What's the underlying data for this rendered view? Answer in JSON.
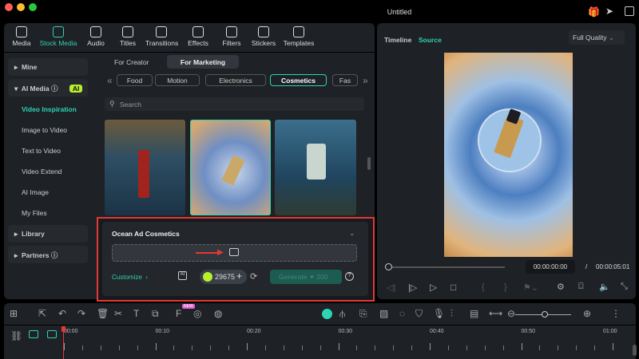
{
  "window": {
    "title": "Untitled"
  },
  "toolbar": [
    {
      "label": "Media",
      "icon": "media-icon"
    },
    {
      "label": "Stock Media",
      "icon": "stock-media-icon",
      "active": true
    },
    {
      "label": "Audio",
      "icon": "audio-icon"
    },
    {
      "label": "Titles",
      "icon": "titles-icon"
    },
    {
      "label": "Transitions",
      "icon": "transitions-icon"
    },
    {
      "label": "Effects",
      "icon": "effects-icon"
    },
    {
      "label": "Filters",
      "icon": "filters-icon"
    },
    {
      "label": "Stickers",
      "icon": "stickers-icon"
    },
    {
      "label": "Templates",
      "icon": "templates-icon"
    }
  ],
  "sidebar": {
    "mine": "Mine",
    "ai_media": "AI Media",
    "ai_badge": "AI",
    "items": [
      "Video Inspiration",
      "Image to Video",
      "Text to Video",
      "Video Extend",
      "AI Image",
      "My Files"
    ],
    "library": "Library",
    "partners": "Partners"
  },
  "tabs": [
    "For Creator",
    "For Marketing"
  ],
  "categories": [
    "Food",
    "Motion",
    "Electronics",
    "Cosmetics",
    "Fas"
  ],
  "search": {
    "placeholder": "Search"
  },
  "generator": {
    "title": "Ocean Ad Cosmetics",
    "customize": "Customize",
    "credits": "29675",
    "generate": "Generate",
    "cost": "200"
  },
  "preview": {
    "tab_timeline": "Timeline",
    "tab_source": "Source",
    "quality": "Full Quality",
    "current_time": "00:00:00:00",
    "separator": "/",
    "total_time": "00:00:05:01",
    "progress": 0
  },
  "timeline": {
    "ticks": [
      "00:00",
      "00:10",
      "00:20",
      "00:30",
      "00:40",
      "00:50",
      "01:00"
    ],
    "new_badge": "NEW"
  },
  "colors": {
    "accent": "#2dd4b5",
    "highlight": "#e53935"
  }
}
